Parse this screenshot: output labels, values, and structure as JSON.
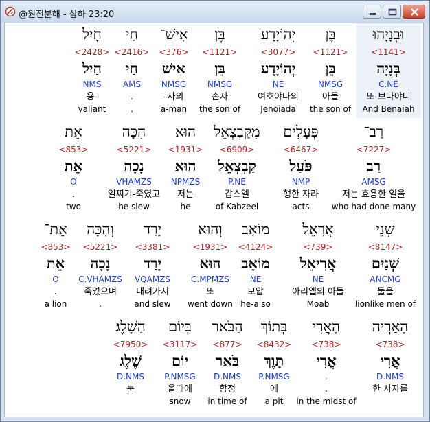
{
  "window": {
    "title": "@원전분해 - 삼하 23:20"
  },
  "rows": [
    [
      {
        "heb": "חָיִל",
        "strong": "<2428>",
        "lemma": "חַיִל",
        "morph": "NMS",
        "kor": "용-",
        "eng": "valiant"
      },
      {
        "heb": "חַי",
        "strong": "<2416>",
        "lemma": "חַי",
        "morph": "AMS",
        "kor": ".",
        "eng": "."
      },
      {
        "heb": "אִישׁ־",
        "strong": "<376>",
        "lemma": "אִישׁ",
        "morph": "NMSG",
        "kor": "-사의",
        "eng": "a-man"
      },
      {
        "heb": "בֶּן",
        "strong": "<1121>",
        "lemma": "בֵּן",
        "morph": "NMSG",
        "kor": "손자",
        "eng": "the son of"
      },
      {
        "heb": "יְהוֹיָדָע",
        "strong": "<3077>",
        "lemma": "יְהוֹיָדָע",
        "morph": "NE",
        "kor": "여호야다의",
        "eng": "Jehoiada"
      },
      {
        "heb": "בֶּן",
        "strong": "<1121>",
        "lemma": "בֵּן",
        "morph": "NMSG",
        "kor": "아들",
        "eng": "the son of"
      },
      {
        "heb": "וּבְנָיָהוּ",
        "strong": "<1141>",
        "lemma": "בְּנָיָה",
        "morph": "C.NE",
        "kor": "또-브나야니",
        "eng": "And Benaiah"
      }
    ],
    [
      {
        "heb": "אֵת",
        "strong": "<853>",
        "lemma": "אֵת",
        "morph": "O",
        "kor": ".",
        "eng": "two"
      },
      {
        "heb": "הִכָּה",
        "strong": "<5221>",
        "lemma": "נָכָה",
        "morph": "VHAMZS",
        "kor": "일찌기-죽였고",
        "eng": "he slew"
      },
      {
        "heb": "הוּא",
        "strong": "<1931>",
        "lemma": "הוּא",
        "morph": "NPMZS",
        "kor": "저는",
        "eng": "he"
      },
      {
        "heb": "מִקַּבְצְאֵל",
        "strong": "<6909>",
        "lemma": "קַבְצְאֵל",
        "morph": "P.NE",
        "kor": "갑스엘",
        "eng": "of Kabzeel"
      },
      {
        "heb": "פְּעָלִים",
        "strong": "<6467>",
        "lemma": "פֹּעַל",
        "morph": "NMP",
        "kor": "행한 자라",
        "eng": "acts"
      },
      {
        "heb": "רַב־",
        "strong": "<7227>",
        "lemma": "רַב",
        "morph": "AMSG",
        "kor": "저는 효용한 일을",
        "eng": "who had done many"
      }
    ],
    [
      {
        "heb": "אֵת־",
        "strong": "<853>",
        "lemma": "אֵת",
        "morph": "O",
        "kor": ".",
        "eng": "a lion"
      },
      {
        "heb": "וְהִכָּה",
        "strong": "<5221>",
        "lemma": "נָכָה",
        "morph": "C.VHAMZS",
        "kor": "죽였으며",
        "eng": "."
      },
      {
        "heb": "יָרַד",
        "strong": "<3381>",
        "lemma": "יָרַד",
        "morph": "VQAMZS",
        "kor": "내려가서",
        "eng": "and slew"
      },
      {
        "heb": "וְהוּא",
        "strong": "<1931>",
        "lemma": "הוּא",
        "morph": "C.MPMZS",
        "kor": "또",
        "eng": "went down"
      },
      {
        "heb": "מוֹאָב",
        "strong": "<4124>",
        "lemma": "מוֹאָב",
        "morph": "NE",
        "kor": "모압",
        "eng": "he-also"
      },
      {
        "heb": "אֲרִאֵל",
        "strong": "<739>",
        "lemma": "אֲרִיאֵל",
        "morph": "NE",
        "kor": "아리엘의 아들",
        "eng": "Moab"
      },
      {
        "heb": "שְׁנֵי",
        "strong": "<8147>",
        "lemma": "שְׁנַיִם",
        "morph": "ANCMG",
        "kor": "둘을",
        "eng": "lionlike men of"
      }
    ],
    [
      {
        "heb": "הַשָּׁלֶג׃",
        "strong": "<7950>",
        "lemma": "שֶׁלֶג",
        "morph": "D.NMS",
        "kor": "눈",
        "eng": ""
      },
      {
        "heb": "בְּיוֹם",
        "strong": "<3117>",
        "lemma": "יוֹם",
        "morph": "P.NMSG",
        "kor": "올때에",
        "eng": "snow"
      },
      {
        "heb": "הַבֹּאר",
        "strong": "<877>",
        "lemma": "בֹּאר",
        "morph": "D.NMS",
        "kor": "함정",
        "eng": "in time of"
      },
      {
        "heb": "בְּתוֹךְ",
        "strong": "<8432>",
        "lemma": "תָּוֶךְ",
        "morph": "P.NMSG",
        "kor": "에",
        "eng": "a pit"
      },
      {
        "heb": "הָאֲרִי",
        "strong": "<738>",
        "lemma": "אֲרִי",
        "morph": ".",
        "kor": ".",
        "eng": "in the midst of"
      },
      {
        "heb": "הָאַרְיֵה",
        "strong": "<738>",
        "lemma": "אֲרִי",
        "morph": "D.NMS",
        "kor": "한 사자를",
        "eng": ""
      }
    ]
  ]
}
